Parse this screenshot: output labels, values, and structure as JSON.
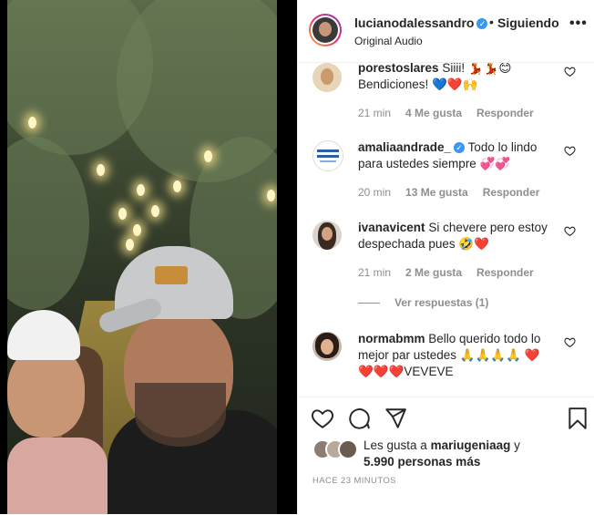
{
  "header": {
    "username": "lucianodalessandro",
    "dot": "•",
    "follow_status": "Siguiendo",
    "audio": "Original Audio",
    "more": "•••"
  },
  "comments": [
    {
      "username": "porestoslares",
      "text": "Siiii! 💃💃😊 Bendiciones! 💙❤️🙌",
      "time": "21 min",
      "likes": "4 Me gusta",
      "reply": "Responder"
    },
    {
      "username": "amaliaandrade_",
      "verified": "✓",
      "text": "Todo lo lindo para ustedes siempre 💞💞",
      "time": "20 min",
      "likes": "13 Me gusta",
      "reply": "Responder"
    },
    {
      "username": "ivanavicent",
      "text": "Si chevere pero estoy despechada pues 🤣❤️",
      "time": "21 min",
      "likes": "2 Me gusta",
      "reply": "Responder"
    },
    {
      "username": "normabmm",
      "text": "Bello querido todo lo mejor par ustedes 🙏🙏🙏🙏 ❤️❤️❤️❤️VEVEVE"
    }
  ],
  "view_replies": "Ver respuestas (1)",
  "likes": {
    "prefix": "Les gusta a",
    "user": "mariugeniaag",
    "and": "y",
    "count": "5.990 personas más"
  },
  "timestamp": "HACE 23 MINUTOS",
  "colors": {
    "accent": "#3897f0",
    "muted": "#8e8e8e",
    "text": "#262626"
  },
  "icons": [
    "heart-icon",
    "comment-icon",
    "share-icon",
    "bookmark-icon",
    "more-icon",
    "verified-icon"
  ]
}
